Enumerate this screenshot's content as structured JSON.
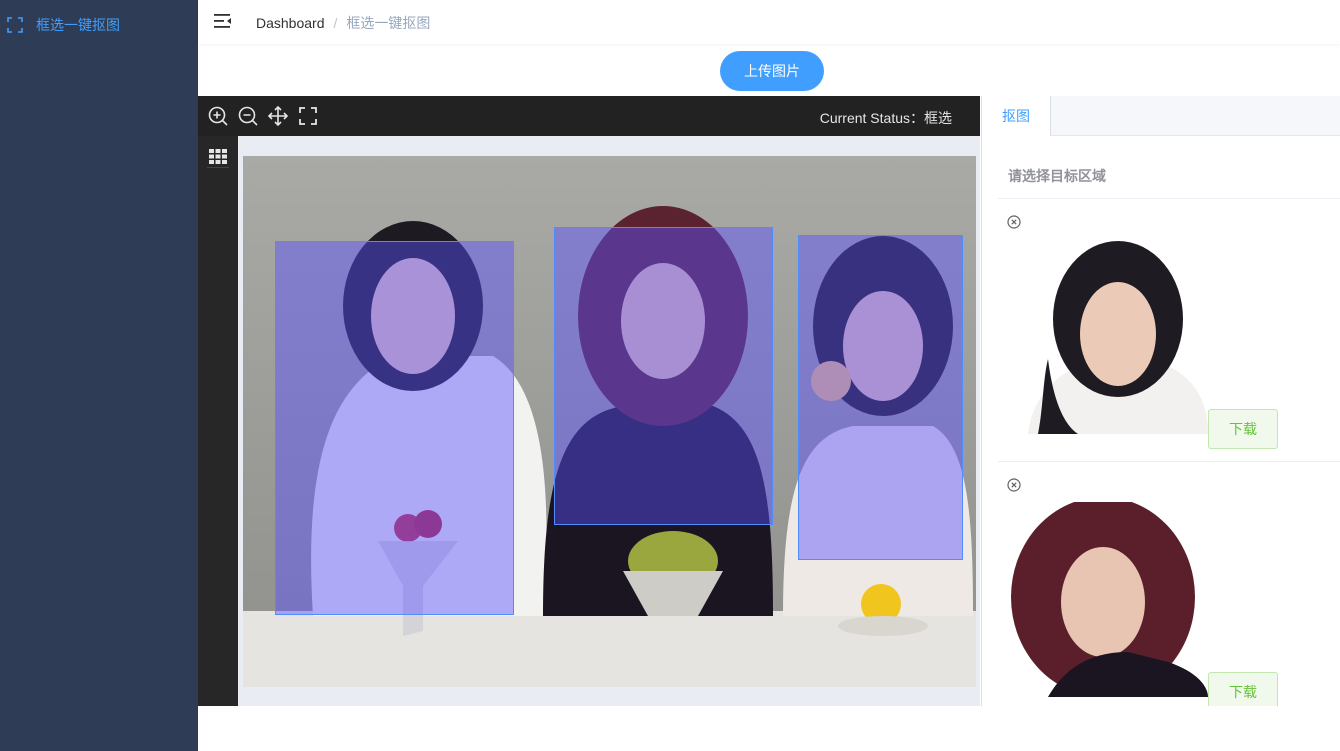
{
  "sidebar": {
    "items": [
      {
        "label": "框选一键抠图",
        "icon": "fullscreen-frame-icon",
        "active": true
      }
    ]
  },
  "header": {
    "menu_icon": "menu-fold-icon",
    "breadcrumb": {
      "root": "Dashboard",
      "separator": "/",
      "current": "框选一键抠图"
    }
  },
  "upload": {
    "label": "上传图片"
  },
  "editor": {
    "tools": [
      "zoom-in-icon",
      "zoom-out-icon",
      "move-icon",
      "fullscreen-icon"
    ],
    "status_text": "Current Status：框选",
    "side_tool": "grid-icon",
    "selections_count": 3
  },
  "panel": {
    "tabs": [
      {
        "label": "抠图",
        "active": true
      }
    ],
    "hint": "请选择目标区域",
    "results": [
      {
        "download_label": "下载",
        "close_icon": "close-circle-icon",
        "hair": "#1f1b22"
      },
      {
        "download_label": "下载",
        "close_icon": "close-circle-icon",
        "hair": "#5a1f2a"
      }
    ]
  },
  "colors": {
    "sidebar_bg": "#2e3d55",
    "accent": "#409eff",
    "selection": "#5a50ff",
    "success": "#67c23a"
  }
}
